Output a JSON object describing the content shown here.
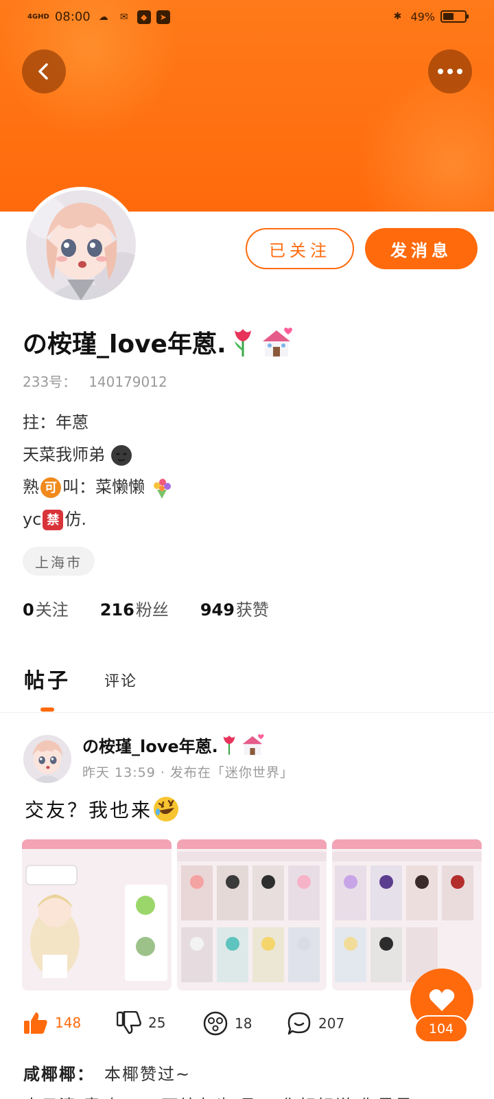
{
  "status_bar": {
    "network": "4GHD",
    "time": "08:00",
    "battery_pct": "49%",
    "battery_level": 0.49
  },
  "header": {
    "back_icon": "chevron-left-icon",
    "more_icon": "more-dots-icon"
  },
  "profile": {
    "follow_label": "已关注",
    "message_label": "发消息",
    "nickname": "の桉瑾_love年蒽.",
    "uid_label": "233号：",
    "uid_value": "140179012",
    "bio_line1": "拄：年蒽",
    "bio_line2": "天菜我师弟",
    "bio_line3_a": "熟",
    "bio_line3_box": "可",
    "bio_line3_b": "叫：菜懒懒",
    "bio_line4_a": "yc",
    "bio_line4_box": "禁",
    "bio_line4_b": "仿.",
    "location": "上海市",
    "following_count": "0",
    "following_label": "关注",
    "fans_count": "216",
    "fans_label": "粉丝",
    "likes_count": "949",
    "likes_label": "获赞"
  },
  "tabs": {
    "posts": "帖子",
    "comments": "评论"
  },
  "post": {
    "author": "の桉瑾_love年蒽.",
    "time": "昨天  13:59",
    "published_in": "· 发布在「迷你世界」",
    "text": "交友？我也来",
    "like_count": "148",
    "dislike_count": "25",
    "wow_count": "18",
    "comment_count": "207",
    "fab_count": "104",
    "comment_author": "咸椰椰：",
    "comment_text": "本椰赞过~",
    "comment_cut": "卢云清 意 如……可结友也 丹… 你好好说 你是是"
  },
  "colors": {
    "accent": "#ff6a0c",
    "header": "#ff7a1a"
  }
}
